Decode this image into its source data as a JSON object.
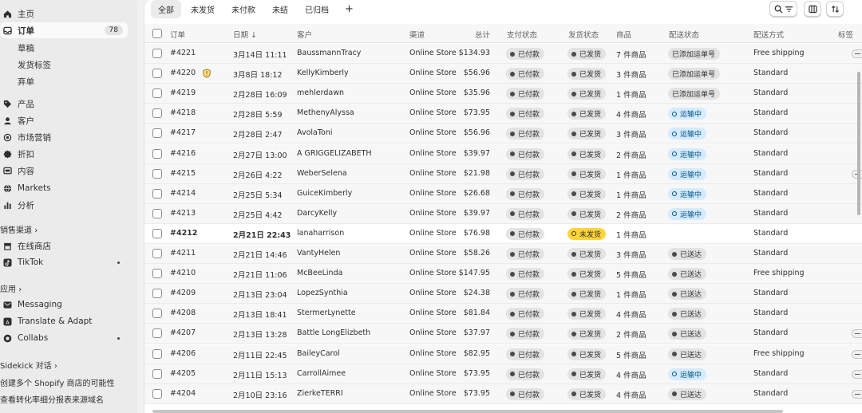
{
  "sidebar": {
    "home": "主页",
    "orders": {
      "label": "订单",
      "badge": "78"
    },
    "orders_sub": [
      "草稿",
      "发货标签",
      "弃单"
    ],
    "products": "产品",
    "customers": "客户",
    "marketing": "市场营销",
    "discounts": "折扣",
    "content": "内容",
    "markets": "Markets",
    "analytics": "分析",
    "sales_channels_header": "销售渠道",
    "online_store": "在线商店",
    "tiktok": "TikTok",
    "apps_header": "应用",
    "messaging": "Messaging",
    "translate": "Translate & Adapt",
    "collabs": "Collabs",
    "sidekick_header": "Sidekick 对话",
    "sidekick_items": [
      "创建多个 Shopify 商店的可能性",
      "查看转化率细分报表来源域名"
    ]
  },
  "tabs": [
    "全部",
    "未发货",
    "未付款",
    "未结",
    "已归档"
  ],
  "tab_add": "+",
  "columns": {
    "order": "订单",
    "date": "日期",
    "date_sort": "↓",
    "customer": "客户",
    "channel": "渠道",
    "total": "总计",
    "payment": "支付状态",
    "fulfillment": "发货状态",
    "items": "商品",
    "delivery": "配送状态",
    "method": "配送方式",
    "tags": "标签"
  },
  "colors": {
    "unfulfilled": "#ffd43b",
    "in_transit": "#d5ebff",
    "neutral": "#e3e3e3"
  },
  "orders": [
    {
      "id": "#4221",
      "date": "3月14日 11:11",
      "customer": "BaussmannTracy",
      "channel": "Online Store",
      "total": "$134.93",
      "payment": "已付款",
      "fulfillment": "已发货",
      "items": "7 件商品",
      "delivery": "已添加运单号",
      "method": "Free shipping"
    },
    {
      "id": "#4220",
      "date": "3月8日 18:12",
      "customer": "KellyKimberly",
      "channel": "Online Store",
      "total": "$56.96",
      "payment": "已付款",
      "fulfillment": "已发货",
      "items": "3 件商品",
      "delivery": "已添加运单号",
      "method": "Standard"
    },
    {
      "id": "#4219",
      "date": "2月28日 16:09",
      "customer": "mehlerdawn",
      "channel": "Online Store",
      "total": "$35.96",
      "payment": "已付款",
      "fulfillment": "已发货",
      "items": "1 件商品",
      "delivery": "已添加运单号",
      "method": "Standard"
    },
    {
      "id": "#4218",
      "date": "2月28日 5:59",
      "customer": "MethenyAlyssa",
      "channel": "Online Store",
      "total": "$73.95",
      "payment": "已付款",
      "fulfillment": "已发货",
      "items": "4 件商品",
      "delivery": "运输中",
      "method": "Standard"
    },
    {
      "id": "#4217",
      "date": "2月28日 2:47",
      "customer": "AvolaToni",
      "channel": "Online Store",
      "total": "$56.96",
      "payment": "已付款",
      "fulfillment": "已发货",
      "items": "3 件商品",
      "delivery": "运输中",
      "method": "Standard"
    },
    {
      "id": "#4216",
      "date": "2月27日 13:00",
      "customer": "A GRIGGELIZABETH",
      "channel": "Online Store",
      "total": "$39.97",
      "payment": "已付款",
      "fulfillment": "已发货",
      "items": "2 件商品",
      "delivery": "运输中",
      "method": "Standard"
    },
    {
      "id": "#4215",
      "date": "2月26日 4:22",
      "customer": "WeberSelena",
      "channel": "Online Store",
      "total": "$21.98",
      "payment": "已付款",
      "fulfillment": "已发货",
      "items": "1 件商品",
      "delivery": "运输中",
      "method": "Standard"
    },
    {
      "id": "#4214",
      "date": "2月25日 5:34",
      "customer": "GuiceKimberly",
      "channel": "Online Store",
      "total": "$26.68",
      "payment": "已付款",
      "fulfillment": "已发货",
      "items": "1 件商品",
      "delivery": "运输中",
      "method": "Standard"
    },
    {
      "id": "#4213",
      "date": "2月25日 4:42",
      "customer": "DarcyKelly",
      "channel": "Online Store",
      "total": "$39.97",
      "payment": "已付款",
      "fulfillment": "已发货",
      "items": "2 件商品",
      "delivery": "运输中",
      "method": "Standard"
    },
    {
      "id": "#4212",
      "date": "2月21日 22:43",
      "customer": "lanaharrison",
      "channel": "Online Store",
      "total": "$76.98",
      "payment": "已付款",
      "fulfillment": "未发货",
      "items": "1 件商品",
      "delivery": "",
      "method": "Standard"
    },
    {
      "id": "#4211",
      "date": "2月21日 14:46",
      "customer": "VantyHelen",
      "channel": "Online Store",
      "total": "$58.26",
      "payment": "已付款",
      "fulfillment": "已发货",
      "items": "3 件商品",
      "delivery": "已送达",
      "method": "Standard"
    },
    {
      "id": "#4210",
      "date": "2月21日 11:06",
      "customer": "McBeeLinda",
      "channel": "Online Store",
      "total": "$147.95",
      "payment": "已付款",
      "fulfillment": "已发货",
      "items": "5 件商品",
      "delivery": "已送达",
      "method": "Free shipping"
    },
    {
      "id": "#4209",
      "date": "2月13日 23:04",
      "customer": "LopezSynthia",
      "channel": "Online Store",
      "total": "$24.38",
      "payment": "已付款",
      "fulfillment": "已发货",
      "items": "1 件商品",
      "delivery": "已送达",
      "method": "Standard"
    },
    {
      "id": "#4208",
      "date": "2月13日 18:41",
      "customer": "StermerLynette",
      "channel": "Online Store",
      "total": "$81.84",
      "payment": "已付款",
      "fulfillment": "已发货",
      "items": "4 件商品",
      "delivery": "已送达",
      "method": "Standard"
    },
    {
      "id": "#4207",
      "date": "2月13日 13:28",
      "customer": "Battle LongElizbeth",
      "channel": "Online Store",
      "total": "$37.97",
      "payment": "已付款",
      "fulfillment": "已发货",
      "items": "2 件商品",
      "delivery": "已送达",
      "method": "Standard"
    },
    {
      "id": "#4206",
      "date": "2月11日 22:45",
      "customer": "BaileyCarol",
      "channel": "Online Store",
      "total": "$82.95",
      "payment": "已付款",
      "fulfillment": "已发货",
      "items": "5 件商品",
      "delivery": "已送达",
      "method": "Free shipping"
    },
    {
      "id": "#4205",
      "date": "2月11日 15:13",
      "customer": "CarrollAimee",
      "channel": "Online Store",
      "total": "$73.95",
      "payment": "已付款",
      "fulfillment": "已发货",
      "items": "4 件商品",
      "delivery": "运输中",
      "method": "Standard"
    },
    {
      "id": "#4204",
      "date": "2月10日 23:16",
      "customer": "ZierkeTERRI",
      "channel": "Online Store",
      "total": "$73.95",
      "payment": "已付款",
      "fulfillment": "已发货",
      "items": "4 件商品",
      "delivery": "已送达",
      "method": "Standard"
    }
  ]
}
